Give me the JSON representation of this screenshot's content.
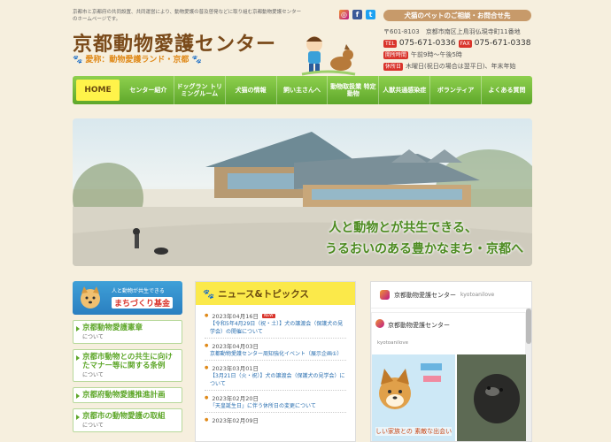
{
  "header": {
    "intro": "京都市と京都府の共同設置、共同運営により、動物愛護の普及啓発などに取り組む京都動物愛護センターのホームページです。",
    "title": "京都動物愛護センター",
    "subtitle": "愛称：動物愛護ランド・京都",
    "pet_button": "犬猫のペットのご相談・お問合せ先",
    "postal": "〒601-8103　京都市南区上鳥羽仏現寺町11番地",
    "tel_label": "TEL",
    "tel": "075-671-0336",
    "fax_label": "FAX",
    "fax": "075-671-0338",
    "hours_label": "開所時間",
    "hours": "午前9時～午後5時",
    "closed_label": "休所日",
    "closed": "木曜日(祝日の場合は翌平日)、年末年始"
  },
  "social": {
    "icons": [
      "instagram-icon",
      "facebook-icon",
      "twitter-icon"
    ],
    "glyphs": [
      "◎",
      "f",
      "t"
    ]
  },
  "nav": {
    "items": [
      "HOME",
      "センター紹介",
      "ドッグラン トリミングルーム",
      "犬猫の情報",
      "飼い主さんへ",
      "動物取扱業 特定動物",
      "人獣共通感染症",
      "ボランティア",
      "よくある質問"
    ]
  },
  "hero": {
    "line1": "人と動物とが共生できる、",
    "line2": "うるおいのある豊かなまち・京都へ"
  },
  "sidebar": {
    "fund_top": "人と動物が共生できる",
    "fund_main": "まちづくり基金",
    "links": [
      {
        "title": "京都動物愛護憲章",
        "sub": "について"
      },
      {
        "title": "京都市動物との共生に向けたマナー等に関する条例",
        "sub": "について"
      },
      {
        "title": "京都府動物愛護推進計画",
        "sub": ""
      },
      {
        "title": "京都市の動物愛護の取組",
        "sub": "について"
      }
    ]
  },
  "news": {
    "heading": "ニュース&トピックス",
    "new_badge": "NEW",
    "items": [
      {
        "date": "2023年04月16日",
        "text": "【令和5年4月29日（祝・土）】犬の譲渡会（保護犬の見学会）の開催について",
        "is_new": true
      },
      {
        "date": "2023年04月03日",
        "text": "京都動物愛護センター周知強化イベント（展示企画①）",
        "is_new": false
      },
      {
        "date": "2023年03月01日",
        "text": "【3月21日（火・祝）】犬の譲渡会（保護犬の見学会）について",
        "is_new": false
      },
      {
        "date": "2023年02月20日",
        "text": "「天皇誕生日」に伴う休所日の変更について",
        "is_new": false
      },
      {
        "date": "2023年02月09日",
        "text": "",
        "is_new": false
      }
    ]
  },
  "instagram": {
    "title": "京都動物愛護センター",
    "handle": "kyotoanilove",
    "card_name": "京都動物愛護センター",
    "card_handle": "kyotoanilove",
    "caption": "しい家族との\n素敵な出会い"
  },
  "colors": {
    "nav_green": "#5ea72a",
    "home_yellow": "#fff34a",
    "brand_brown": "#7a4a1a",
    "accent_orange": "#e08a1a",
    "news_yellow": "#fbe94a"
  }
}
